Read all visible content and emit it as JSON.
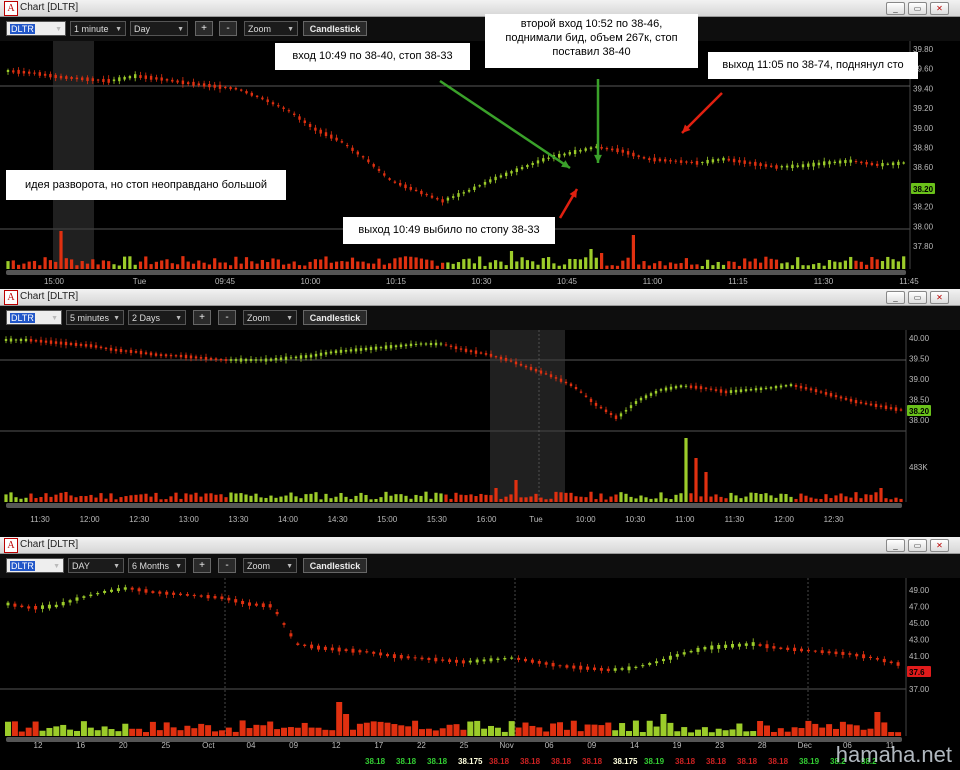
{
  "windows": [
    {
      "title": "Chart [DLTR]",
      "symbol": "DLTR",
      "interval": "1 minute",
      "range": "Day",
      "zoom": "Zoom",
      "chart_type": "Candlestick",
      "plus": "+",
      "minus": "-",
      "last_price": "38.20",
      "y_ticks": [
        "39.80",
        "39.60",
        "39.40",
        "39.20",
        "39.00",
        "38.80",
        "38.60",
        "38.40",
        "38.20",
        "38.00",
        "37.80"
      ],
      "x_ticks": [
        "15:00",
        "Tue",
        "09:45",
        "10:00",
        "10:15",
        "10:30",
        "10:45",
        "11:00",
        "11:15",
        "11:30",
        "11:45"
      ]
    },
    {
      "title": "Chart [DLTR]",
      "symbol": "DLTR",
      "interval": "5 minutes",
      "range": "2 Days",
      "zoom": "Zoom",
      "chart_type": "Candlestick",
      "plus": "+",
      "minus": "-",
      "last_price": "38.20",
      "volume_label": "483K",
      "y_ticks": [
        "40.00",
        "39.50",
        "39.00",
        "38.50",
        "38.00"
      ],
      "x_ticks": [
        "11:30",
        "12:00",
        "12:30",
        "13:00",
        "13:30",
        "14:00",
        "14:30",
        "15:00",
        "15:30",
        "16:00",
        "Tue",
        "10:00",
        "10:30",
        "11:00",
        "11:30",
        "12:00",
        "12:30"
      ]
    },
    {
      "title": "Chart [DLTR]",
      "symbol": "DLTR",
      "interval": "DAY",
      "range": "6 Months",
      "zoom": "Zoom",
      "chart_type": "Candlestick",
      "plus": "+",
      "minus": "-",
      "last_price": "37.6",
      "y_ticks": [
        "49.00",
        "47.00",
        "45.00",
        "43.00",
        "41.00",
        "39.00",
        "37.00"
      ],
      "x_ticks": [
        "12",
        "16",
        "20",
        "25",
        "Oct",
        "04",
        "09",
        "12",
        "17",
        "22",
        "25",
        "Nov",
        "06",
        "09",
        "14",
        "19",
        "23",
        "28",
        "Dec",
        "06",
        "11"
      ],
      "tape": [
        {
          "p": "38.18",
          "c": "#3c3"
        },
        {
          "p": "38.18",
          "c": "#3c3"
        },
        {
          "p": "38.18",
          "c": "#3c3"
        },
        {
          "p": "38.175",
          "c": "#ffd"
        },
        {
          "p": "38.18",
          "c": "#c22"
        },
        {
          "p": "38.18",
          "c": "#c22"
        },
        {
          "p": "38.18",
          "c": "#c22"
        },
        {
          "p": "38.18",
          "c": "#c22"
        },
        {
          "p": "38.175",
          "c": "#ffd"
        },
        {
          "p": "38.19",
          "c": "#3c3"
        },
        {
          "p": "38.18",
          "c": "#c22"
        },
        {
          "p": "38.18",
          "c": "#c22"
        },
        {
          "p": "38.18",
          "c": "#c22"
        },
        {
          "p": "38.18",
          "c": "#c22"
        },
        {
          "p": "38.19",
          "c": "#3c3"
        },
        {
          "p": "38.2",
          "c": "#3c3"
        },
        {
          "p": "38.2",
          "c": "#3c3"
        }
      ]
    }
  ],
  "annotations": {
    "idea": "идея разворота, но стоп неоправдано большой",
    "entry1": "вход 10:49 по 38-40, стоп 38-33",
    "entry2": "второй вход 10:52 по 38-46, поднимали бид, объем 267к, стоп поставил 38-40",
    "exit_stop": "выход 10:49 выбило по стопу 38-33",
    "exit_final": "выход 11:05 по 38-74, поднянул сто"
  },
  "watermark": "hamaha.net",
  "colors": {
    "up": "#9ccc2a",
    "down": "#e03010",
    "bg": "#000000",
    "price_tag_up": "#6ac11a",
    "price_tag_down": "#e01b1b"
  }
}
